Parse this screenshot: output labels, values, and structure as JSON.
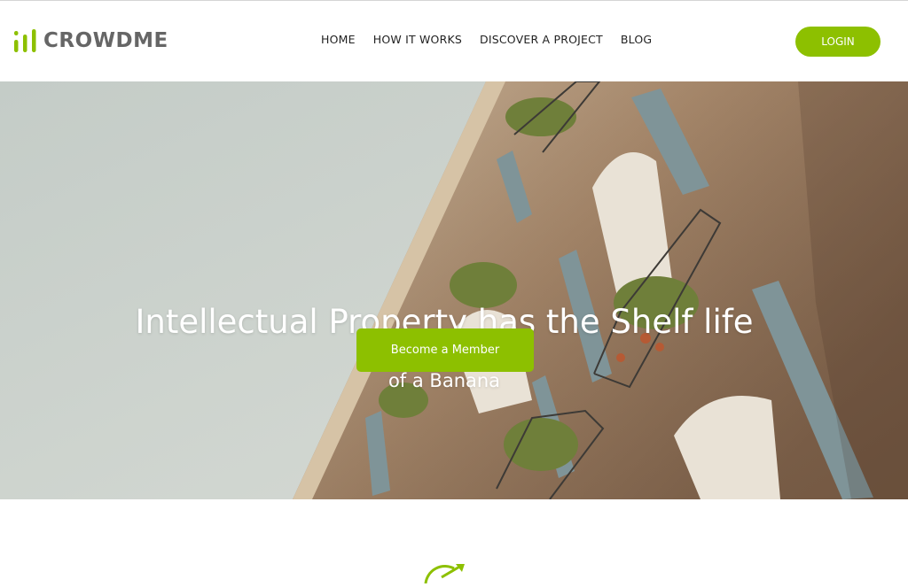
{
  "brand": {
    "name": "CROWDME",
    "logo_icon": "bar-chart-icon"
  },
  "nav": {
    "items": [
      {
        "label": "HOME"
      },
      {
        "label": "HOW IT WORKS"
      },
      {
        "label": "DISCOVER A PROJECT"
      },
      {
        "label": "BLOG"
      }
    ]
  },
  "header": {
    "login_label": "LOGIN"
  },
  "hero": {
    "title": "Intellectual Property has the Shelf life",
    "subtitle": "of a Banana",
    "cta_label": "Become a Member",
    "background": "building-facade-photo"
  },
  "section": {
    "icon": "growth-arrow-icon"
  },
  "colors": {
    "accent": "#8dc000",
    "logo_gray": "#666666",
    "nav_text": "#222222",
    "hero_sky": "#c9cfcb"
  }
}
